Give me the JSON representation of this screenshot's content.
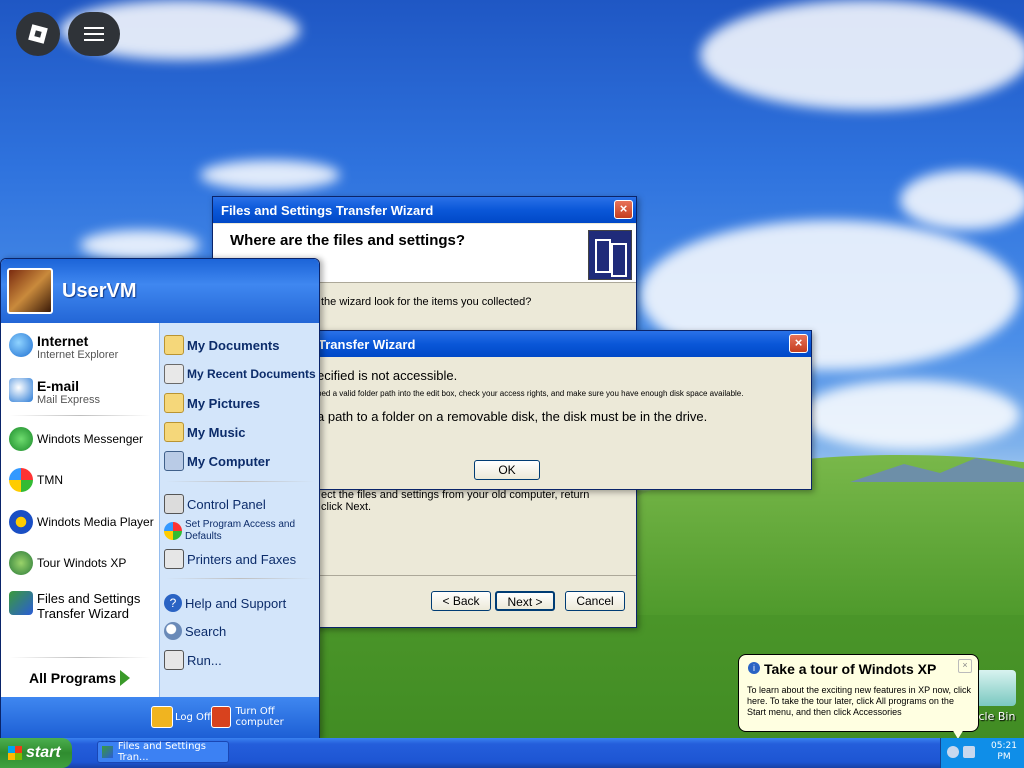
{
  "topbar": {
    "roblox_icon": "roblox-logo-icon",
    "menu_icon": "hamburger-menu-icon"
  },
  "wizard": {
    "title": "Files and Settings Transfer Wizard",
    "heading": "Where are the files and settings?",
    "question_partial": "the wizard look for the items you collected?",
    "body_partial_line1": "ect the files and settings from your old computer, return",
    "body_partial_line2": "click Next.",
    "back_label": "< Back",
    "next_label": "Next >",
    "cancel_label": "Cancel"
  },
  "error_dialog": {
    "title_partial": "Transfer Wizard",
    "line1_partial": "ecified is not accessible.",
    "line2_partial": "ped a valid folder path into the edit box, check your access rights, and make sure you have enough disk space available.",
    "line3_partial": "a path to a folder on a removable disk, the disk must be in the drive.",
    "ok_label": "OK"
  },
  "start_menu": {
    "user": "UserVM",
    "pinned": [
      {
        "label": "Internet",
        "sub": "Internet Explorer",
        "icon": "internet-explorer-icon"
      },
      {
        "label": "E-mail",
        "sub": "Mail Express",
        "icon": "mail-icon"
      }
    ],
    "recent": [
      {
        "label": "Windots Messenger",
        "icon": "messenger-icon"
      },
      {
        "label": "TMN",
        "icon": "tmn-butterfly-icon"
      },
      {
        "label": "Windots Media Player",
        "icon": "media-player-icon"
      },
      {
        "label": "Tour Windots XP",
        "icon": "tour-icon"
      },
      {
        "label": "Files and Settings Transfer Wizard",
        "icon": "transfer-wizard-icon"
      }
    ],
    "all_programs": "All Programs",
    "right": [
      {
        "label": "My Documents",
        "icon": "folder-icon"
      },
      {
        "label": "My Recent Documents",
        "icon": "recent-documents-icon"
      },
      {
        "label": "My Pictures",
        "icon": "pictures-icon"
      },
      {
        "label": "My Music",
        "icon": "music-icon"
      },
      {
        "label": "My Computer",
        "icon": "computer-icon"
      },
      {
        "label": "Control Panel",
        "icon": "control-panel-icon"
      },
      {
        "label": "Set Program Access and Defaults",
        "icon": "program-access-icon"
      },
      {
        "label": "Printers and Faxes",
        "icon": "printer-icon"
      },
      {
        "label": "Help and Support",
        "icon": "help-icon"
      },
      {
        "label": "Search",
        "icon": "search-icon"
      },
      {
        "label": "Run...",
        "icon": "run-icon"
      }
    ],
    "log_off": "Log Off",
    "turn_off": "Turn Off computer"
  },
  "balloon": {
    "title": "Take a tour of Windots XP",
    "text": "To learn about the exciting new features in XP now, click here. To take the tour later, click All programs on the Start menu, and then click Accessories",
    "close_icon": "close-icon"
  },
  "desktop": {
    "recycle_bin": "ycle Bin"
  },
  "taskbar": {
    "start_label": "start",
    "task_label": "Files and Settings Tran...",
    "clock_time": "05:21",
    "clock_ampm": "PM"
  }
}
